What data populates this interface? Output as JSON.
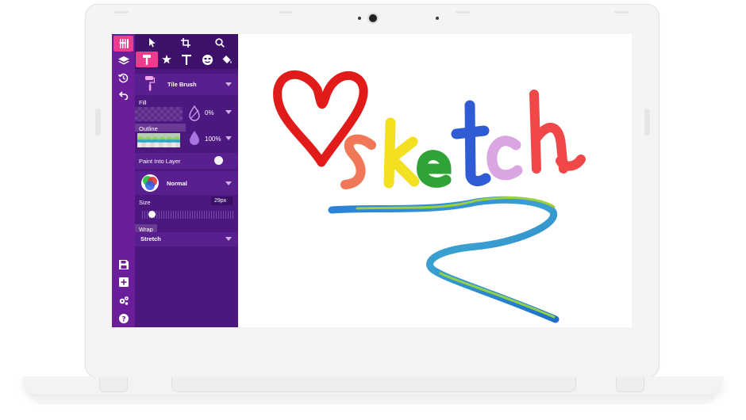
{
  "toolbar": {
    "top_icons": [
      "move-icon",
      "crop-icon",
      "search-icon"
    ],
    "second_icons": [
      "brush-icon",
      "star-icon",
      "text-icon",
      "emoji-icon",
      "paint-bucket-icon"
    ]
  },
  "rail": {
    "icons_top": [
      "utensils-icon",
      "layers-icon",
      "history-icon",
      "undo-icon"
    ],
    "icons_bottom": [
      "save-icon",
      "add-icon",
      "settings-icon",
      "help-icon"
    ]
  },
  "brush": {
    "name": "Tile Brush"
  },
  "fill": {
    "label": "Fill",
    "opacity": "0%"
  },
  "outline": {
    "label": "Outline",
    "opacity": "100%"
  },
  "paint_into_layer": {
    "label": "Paint Into Layer",
    "enabled": false
  },
  "blend": {
    "mode": "Normal"
  },
  "size": {
    "label": "Size",
    "value": "29px",
    "fraction": 0.08
  },
  "wrap": {
    "label": "Wrap",
    "value": "Stretch"
  },
  "canvas": {
    "word": "sketch"
  },
  "colors": {
    "rail": "#6a1e9a",
    "panel": "#4d1780",
    "accent": "#ee3b8e"
  }
}
